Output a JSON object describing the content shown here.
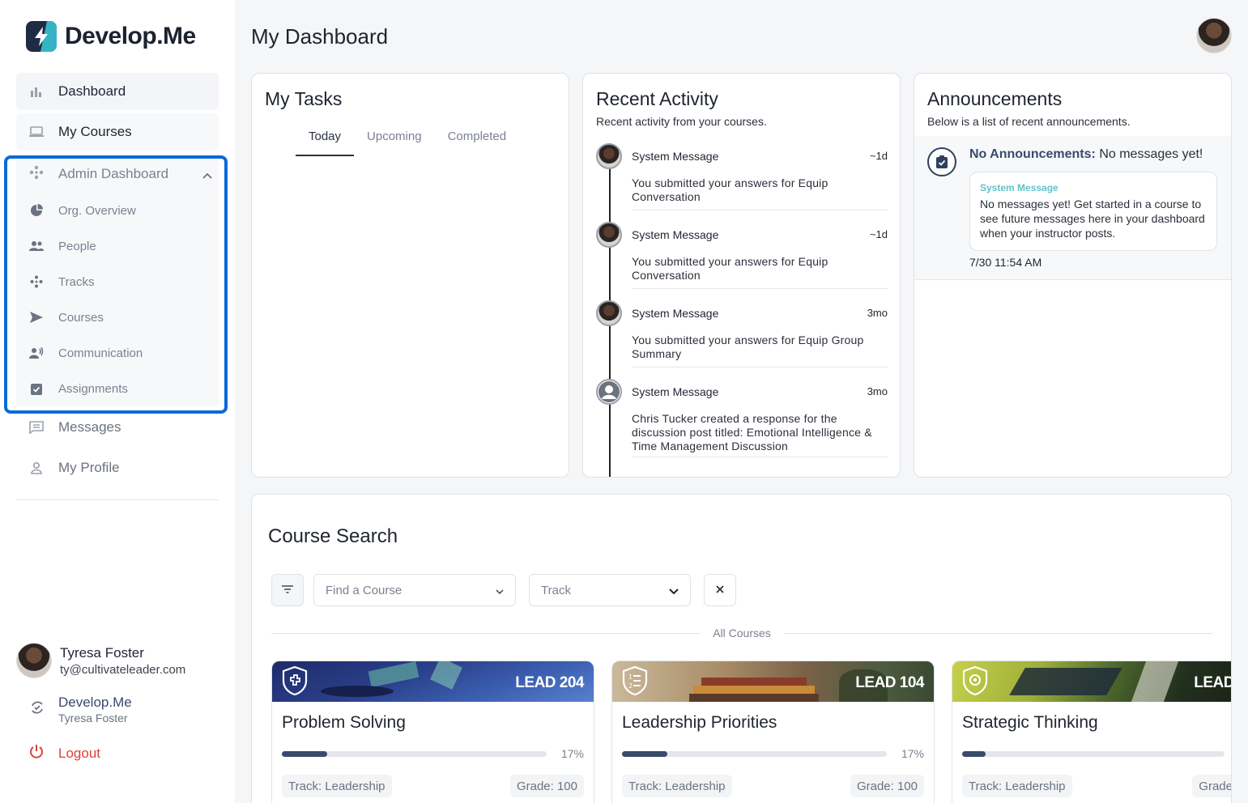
{
  "app": {
    "brand": "Develop.Me",
    "page_title": "My Dashboard"
  },
  "sidebar": {
    "items": [
      {
        "label": "Dashboard",
        "icon": "bar-chart-icon"
      },
      {
        "label": "My Courses",
        "icon": "laptop-icon"
      }
    ],
    "admin": {
      "label": "Admin Dashboard",
      "expanded": true,
      "items": [
        {
          "label": "Org. Overview",
          "icon": "pie-chart-icon"
        },
        {
          "label": "People",
          "icon": "people-icon"
        },
        {
          "label": "Tracks",
          "icon": "tracks-icon"
        },
        {
          "label": "Courses",
          "icon": "send-icon"
        },
        {
          "label": "Communication",
          "icon": "speaker-icon"
        },
        {
          "label": "Assignments",
          "icon": "clipboard-check-icon"
        }
      ]
    },
    "after": [
      {
        "label": "Messages",
        "icon": "message-icon"
      },
      {
        "label": "My Profile",
        "icon": "person-icon"
      }
    ],
    "user": {
      "name": "Tyresa Foster",
      "email": "ty@cultivateleader.com"
    },
    "org": {
      "name": "Develop.Me",
      "user": "Tyresa Foster"
    },
    "logout": "Logout"
  },
  "tasks": {
    "title": "My Tasks",
    "tabs": [
      "Today",
      "Upcoming",
      "Completed"
    ],
    "active_tab": "Today"
  },
  "activity": {
    "title": "Recent Activity",
    "subtitle": "Recent activity from your courses.",
    "items": [
      {
        "title": "System Message",
        "time": "~1d",
        "body": "You submitted your answers for Equip Conversation"
      },
      {
        "title": "System Message",
        "time": "~1d",
        "body": "You submitted your answers for Equip Conversation"
      },
      {
        "title": "System Message",
        "time": "3mo",
        "body": "You submitted your answers for Equip Group Summary"
      },
      {
        "title": "System Message",
        "time": "3mo",
        "body": "Chris Tucker created a response for the discussion post titled: Emotional Intelligence & Time Management Discussion"
      }
    ]
  },
  "announcements": {
    "title": "Announcements",
    "subtitle": "Below is a list of recent announcements.",
    "heading_bold": "No Announcements:",
    "heading_rest": "No messages yet!",
    "system_label": "System Message",
    "message": "No messages yet! Get started in a course to see future messages here in your dashboard when your instructor posts.",
    "date": "7/30 11:54 AM"
  },
  "search": {
    "title": "Course Search",
    "find_placeholder": "Find a Course",
    "track_placeholder": "Track",
    "divider_label": "All Courses",
    "courses": [
      {
        "code": "LEAD 204",
        "title": "Problem Solving",
        "progress": 17,
        "progress_label": "17%",
        "track": "Track: Leadership",
        "grade": "Grade: 100"
      },
      {
        "code": "LEAD 104",
        "title": "Leadership Priorities",
        "progress": 17,
        "progress_label": "17%",
        "track": "Track: Leadership",
        "grade": "Grade: 100"
      },
      {
        "code": "LEAD",
        "title": "Strategic Thinking",
        "progress": 9,
        "progress_label": "",
        "track": "Track: Leadership",
        "grade": "Grade"
      }
    ]
  },
  "colors": {
    "accent": "#3a4a6b",
    "highlight": "#0a6bd6",
    "logout": "#e0403a",
    "teal": "#5fc4c9"
  }
}
